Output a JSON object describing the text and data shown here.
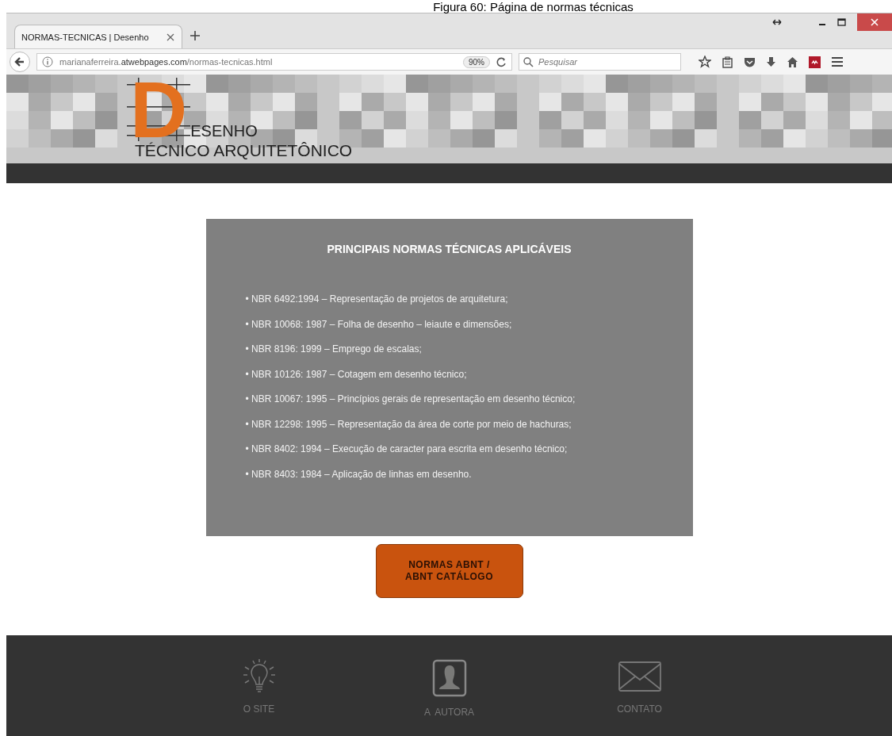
{
  "caption": "Figura 60: Página de normas técnicas",
  "browser": {
    "tab_title": "NORMAS-TECNICAS | Desenho",
    "url": "marianaferreira.**atwebpages.com**/normas-tecnicas.html",
    "zoom": "90%",
    "search": {
      "placeholder": "Pesquisar"
    }
  },
  "header": {
    "logo_letter": "D",
    "logo_line_1": "ESENHO",
    "logo_line_2": "TÉCNICO ARQUITETÔNICO"
  },
  "panel": {
    "title": "PRINCIPAIS NORMAS TÉCNICAS APLICÁVEIS",
    "items": [
      "• NBR 6492:1994 – Representação de projetos de arquitetura;",
      "• NBR 10068: 1987 – Folha de desenho – leiaute e dimensões;",
      "• NBR 8196: 1999 – Emprego de escalas;",
      "• NBR 10126: 1987 – Cotagem em desenho técnico;",
      "• NBR 10067: 1995 – Princípios gerais de representação em desenho técnico;",
      "• NBR 12298: 1995 – Representação da área de corte por meio de hachuras;",
      "• NBR 8402: 1994 – Execução de caracter para escrita em desenho técnico;",
      "• NBR 8403: 1984 – Aplicação de linhas em desenho."
    ]
  },
  "button": "NORMAS ABNT / ABNT CATÁLOGO",
  "footer": {
    "links": [
      {
        "kind": "bulb",
        "label": "O SITE"
      },
      {
        "kind": "person",
        "label": "A  AUTORA"
      },
      {
        "kind": "envelope",
        "label": "CONTATO"
      }
    ]
  }
}
